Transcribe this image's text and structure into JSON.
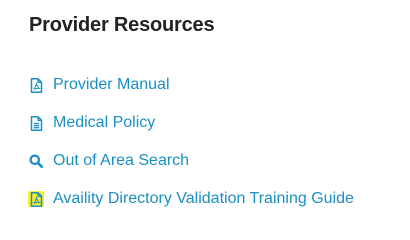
{
  "section": {
    "title": "Provider Resources"
  },
  "links": [
    {
      "label": "Provider Manual",
      "icon": "pdf-file-icon",
      "highlighted": false
    },
    {
      "label": "Medical Policy",
      "icon": "document-icon",
      "highlighted": false
    },
    {
      "label": "Out of Area Search",
      "icon": "search-icon",
      "highlighted": false
    },
    {
      "label": "Availity Directory Validation Training Guide",
      "icon": "pdf-file-icon",
      "highlighted": true
    }
  ],
  "colors": {
    "heading": "#222222",
    "link": "#1a8fc4",
    "highlight": "#f5ef2c"
  }
}
